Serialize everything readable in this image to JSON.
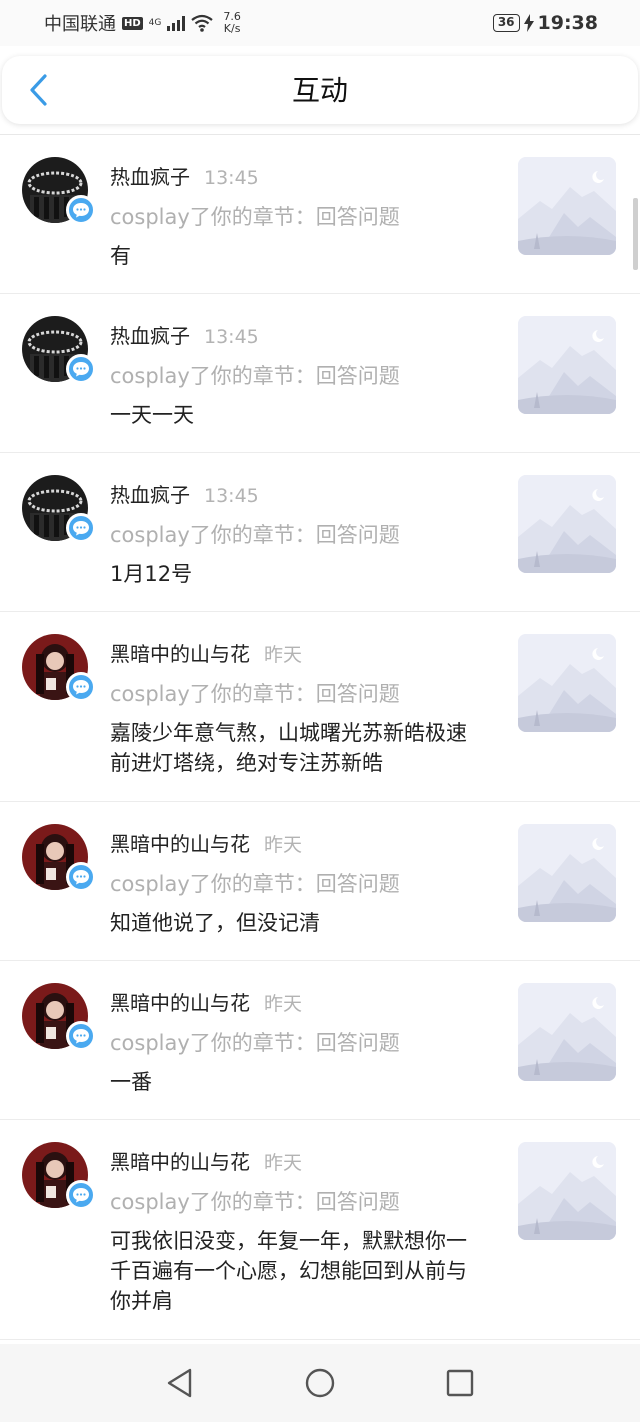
{
  "status_bar": {
    "carrier": "中国联通",
    "hd": "HD",
    "network": "4G",
    "speed_value": "7.6",
    "speed_unit": "K/s",
    "battery": "36",
    "time": "19:38"
  },
  "header": {
    "title": "互动",
    "back_icon": "chevron-left-icon"
  },
  "notifications": [
    {
      "user": "热血疯子",
      "time": "13:45",
      "action": "cosplay了你的章节：回答问题",
      "comment": "有",
      "avatar": "dark"
    },
    {
      "user": "热血疯子",
      "time": "13:45",
      "action": "cosplay了你的章节：回答问题",
      "comment": "一天一天",
      "avatar": "dark"
    },
    {
      "user": "热血疯子",
      "time": "13:45",
      "action": "cosplay了你的章节：回答问题",
      "comment": "1月12号",
      "avatar": "dark"
    },
    {
      "user": "黑暗中的山与花",
      "time": "昨天",
      "action": "cosplay了你的章节：回答问题",
      "comment": "嘉陵少年意气熬，山城曙光苏新皓极速前进灯塔绕，绝对专注苏新皓",
      "avatar": "red"
    },
    {
      "user": "黑暗中的山与花",
      "time": "昨天",
      "action": "cosplay了你的章节：回答问题",
      "comment": "知道他说了，但没记清",
      "avatar": "red"
    },
    {
      "user": "黑暗中的山与花",
      "time": "昨天",
      "action": "cosplay了你的章节：回答问题",
      "comment": "一番",
      "avatar": "red"
    },
    {
      "user": "黑暗中的山与花",
      "time": "昨天",
      "action": "cosplay了你的章节：回答问题",
      "comment": "可我依旧没变，年复一年，默默想你一千百遍有一个心愿，幻想能回到从前与你并肩",
      "avatar": "red"
    }
  ],
  "colors": {
    "accent": "#3a9be6",
    "badge": "#4aa9f0",
    "muted_text": "#b0b0b0",
    "thumb_bg": "#eceef7"
  },
  "nav": {
    "back_icon": "triangle-back-icon",
    "home_icon": "circle-home-icon",
    "recents_icon": "square-recents-icon"
  }
}
